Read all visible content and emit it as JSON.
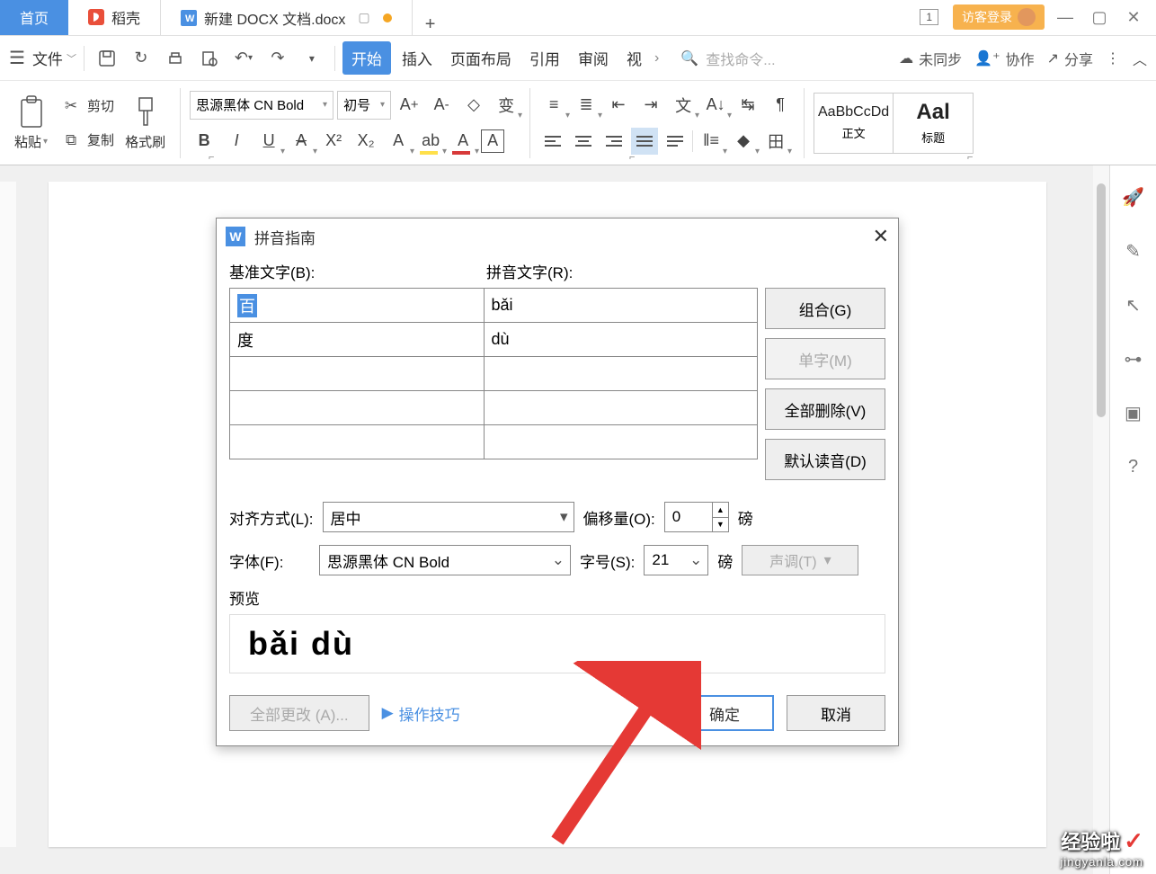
{
  "tabs": {
    "home": "首页",
    "doc2": "稻壳",
    "doc3": "新建 DOCX 文档.docx",
    "newtab": "+",
    "winnum": "1",
    "login": "访客登录"
  },
  "menu": {
    "file": "文件",
    "start": "开始",
    "insert": "插入",
    "layout": "页面布局",
    "ref": "引用",
    "review": "审阅",
    "view": "视",
    "search_ph": "查找命令...",
    "unsync": "未同步",
    "collab": "协作",
    "share": "分享"
  },
  "ribbon": {
    "paste": "粘贴",
    "cut": "剪切",
    "copy": "复制",
    "format": "格式刷",
    "font_name": "思源黑体 CN Bold",
    "font_size": "初号",
    "style_body_sample": "AaBbCcDd",
    "style_body": "正文",
    "style_title_sample": "Aal",
    "style_title": "标题"
  },
  "dialog": {
    "title": "拼音指南",
    "base_hdr": "基准文字(B):",
    "ruby_hdr": "拼音文字(R):",
    "rows": [
      {
        "base": "百",
        "ruby": "bǎi"
      },
      {
        "base": "度",
        "ruby": "dù"
      },
      {
        "base": "",
        "ruby": ""
      },
      {
        "base": "",
        "ruby": ""
      },
      {
        "base": "",
        "ruby": ""
      }
    ],
    "btn_combine": "组合(G)",
    "btn_single": "单字(M)",
    "btn_delall": "全部删除(V)",
    "btn_default": "默认读音(D)",
    "align_lbl": "对齐方式(L):",
    "align_val": "居中",
    "offset_lbl": "偏移量(O):",
    "offset_val": "0",
    "unit": "磅",
    "font_lbl": "字体(F):",
    "font_val": "思源黑体 CN Bold",
    "size_lbl": "字号(S):",
    "size_val": "21",
    "tone": "声调(T)",
    "preview_lbl": "预览",
    "preview_text": "bǎi  dù",
    "changeall": "全部更改 (A)...",
    "tips": "操作技巧",
    "ok": "确定",
    "cancel": "取消"
  },
  "watermark": {
    "line1": "经验啦",
    "line2": "jingyanla.com"
  }
}
